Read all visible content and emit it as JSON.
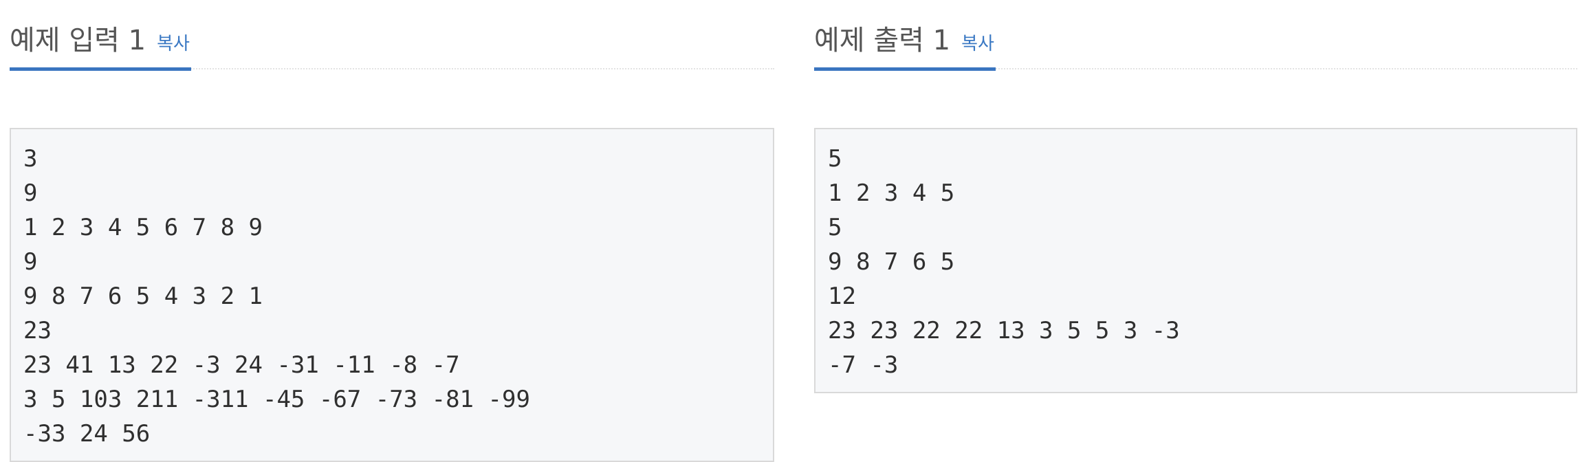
{
  "input_section": {
    "title": "예제 입력 1",
    "copy_label": "복사",
    "lines": [
      "3",
      "9",
      "1 2 3 4 5 6 7 8 9",
      "9",
      "9 8 7 6 5 4 3 2 1",
      "23",
      "23 41 13 22 -3 24 -31 -11 -8 -7",
      "3 5 103 211 -311 -45 -67 -73 -81 -99",
      "-33 24 56"
    ]
  },
  "output_section": {
    "title": "예제 출력 1",
    "copy_label": "복사",
    "lines": [
      "5",
      "1 2 3 4 5",
      "5",
      "9 8 7 6 5",
      "12",
      "23 23 22 22 13 3 5 5 3 -3",
      "-7 -3"
    ]
  },
  "colors": {
    "accent": "#3a75c0",
    "link": "#3a78c3",
    "title_text": "#555555",
    "pre_background": "#f6f7f9",
    "pre_border": "#d9d9d9"
  }
}
